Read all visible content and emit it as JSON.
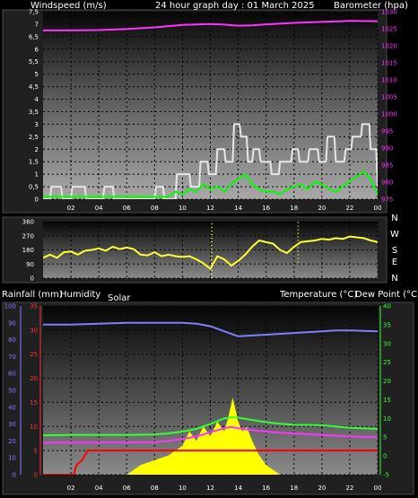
{
  "header": {
    "windspeed_label": "Windspeed (m/s)",
    "title": "24 hour graph day : 01 March 2025",
    "barometer_label": "Barometer (hpa)"
  },
  "labels": {
    "rainfall": "Rainfall (mm)",
    "humidity": "Humidity",
    "solar": "Solar",
    "temperature": "Temperature (°C)",
    "dew_point": "Dew Point (°C)"
  },
  "compass": [
    "N",
    "W",
    "S",
    "E",
    "N"
  ],
  "colors": {
    "wind_speed": "#e6e6e6",
    "wind_gust_avg": "#00ff00",
    "barometer": "#ff33ff",
    "direction": "#ffff33",
    "humidity": "#7f7fff",
    "temperature": "#33ff33",
    "dew_point": "#ff33ff",
    "solar": "#ffff00",
    "rain": "#ff0000",
    "wind_axis": "#ffffff",
    "baro_axis": "#ff33ff",
    "rain_axis": "#ff3333",
    "humidity_axis": "#7f7fff",
    "temp_axis": "#33ff33"
  },
  "chart_data": [
    {
      "type": "line",
      "name": "wind-baro",
      "x_ticks": [
        "02",
        "04",
        "06",
        "08",
        "10",
        "12",
        "14",
        "16",
        "18",
        "20",
        "22",
        "00"
      ],
      "x_range_hours": [
        0,
        24
      ],
      "y_left": {
        "label": "Windspeed (m/s)",
        "range": [
          0,
          7.5
        ],
        "ticks": [
          "0",
          "0,5",
          "1",
          "1,5",
          "2",
          "2,5",
          "3",
          "3,5",
          "4",
          "4,5",
          "5",
          "5,5",
          "6",
          "6,5",
          "7",
          "7,5"
        ]
      },
      "y_right": {
        "label": "Barometer (hpa)",
        "range": [
          975,
          1030
        ],
        "ticks": [
          "975",
          "980",
          "985",
          "990",
          "995",
          "1000",
          "1005",
          "1010",
          "1015",
          "1020",
          "1025",
          "1030"
        ]
      },
      "barometer": {
        "x": [
          0,
          2,
          4,
          6,
          8,
          10,
          12,
          13,
          14,
          15,
          16,
          18,
          20,
          22,
          24
        ],
        "y": [
          1024.5,
          1024.5,
          1024.6,
          1024.9,
          1025.4,
          1026.1,
          1026.4,
          1026.2,
          1025.9,
          1026,
          1026.3,
          1026.7,
          1027,
          1027.3,
          1027.2
        ]
      },
      "wind_gust": {
        "x": [
          0,
          0.5,
          0.6,
          1.3,
          1.4,
          2,
          2.1,
          3,
          3.1,
          4.3,
          4.4,
          5,
          5.1,
          8,
          8.1,
          8.6,
          8.7,
          9.5,
          9.6,
          10.5,
          10.6,
          11.2,
          11.3,
          11.8,
          11.9,
          12.4,
          12.5,
          13,
          13.1,
          13.6,
          13.7,
          14.1,
          14.2,
          14.6,
          14.7,
          15,
          15.1,
          15.5,
          15.6,
          16.3,
          16.4,
          16.9,
          17,
          17.8,
          17.9,
          18.3,
          18.4,
          19,
          19.1,
          19.7,
          19.8,
          20.3,
          20.4,
          20.9,
          21,
          21.6,
          21.7,
          22.1,
          22.2,
          22.8,
          22.9,
          23.4,
          23.5,
          23.9,
          24
        ],
        "y": [
          0,
          0,
          0.5,
          0.5,
          0,
          0,
          0.5,
          0.5,
          0,
          0,
          0.5,
          0.5,
          0,
          0,
          0.5,
          0.5,
          0,
          0,
          1,
          1,
          0.5,
          0.5,
          1.5,
          1.5,
          1,
          1,
          2,
          2,
          1.5,
          1.5,
          3,
          3,
          2.5,
          2.5,
          1.5,
          1.5,
          2,
          2,
          1.5,
          1.5,
          1,
          1,
          1.5,
          1.5,
          2,
          2,
          1.5,
          1.5,
          2,
          2,
          1.5,
          1.5,
          2.5,
          2.5,
          1.5,
          1.5,
          2,
          2,
          2.5,
          2.5,
          3,
          3,
          2,
          2,
          0.5
        ]
      },
      "wind_avg": {
        "x": [
          0,
          1,
          2,
          3,
          4,
          5,
          6,
          7,
          8,
          9,
          9.5,
          10,
          10.5,
          11,
          11.5,
          12,
          12.5,
          13,
          13.5,
          14,
          14.5,
          15,
          15.5,
          16,
          16.5,
          17,
          17.5,
          18,
          18.5,
          19,
          19.5,
          20,
          20.5,
          21,
          21.5,
          22,
          22.5,
          23,
          23.5,
          24
        ],
        "y": [
          0.1,
          0.1,
          0.1,
          0.1,
          0.1,
          0.1,
          0.1,
          0.1,
          0.1,
          0.1,
          0.3,
          0.2,
          0.4,
          0.3,
          0.6,
          0.4,
          0.5,
          0.3,
          0.6,
          0.8,
          1,
          0.6,
          0.4,
          0.3,
          0.3,
          0.2,
          0.4,
          0.5,
          0.6,
          0.4,
          0.7,
          0.6,
          0.4,
          0.3,
          0.5,
          0.7,
          0.9,
          1.1,
          0.8,
          0.2
        ]
      }
    },
    {
      "type": "line",
      "name": "wind-direction",
      "y_range": [
        0,
        360
      ],
      "y_ticks": [
        "0",
        "90",
        "180",
        "270",
        "360"
      ],
      "x": [
        0,
        0.5,
        1,
        1.5,
        2,
        2.5,
        3,
        3.5,
        4,
        4.5,
        5,
        5.5,
        6,
        6.5,
        7,
        7.5,
        8,
        8.5,
        9,
        9.5,
        10,
        10.5,
        11,
        11.5,
        12,
        12.5,
        13,
        13.5,
        14,
        14.5,
        15,
        15.5,
        16,
        16.5,
        17,
        17.5,
        18,
        18.5,
        19,
        19.5,
        20,
        20.5,
        21,
        21.5,
        22,
        22.5,
        23,
        23.5,
        24
      ],
      "y": [
        130,
        150,
        130,
        165,
        170,
        150,
        175,
        180,
        190,
        175,
        200,
        185,
        195,
        185,
        150,
        145,
        165,
        140,
        150,
        140,
        135,
        140,
        120,
        95,
        60,
        140,
        120,
        80,
        110,
        150,
        200,
        240,
        230,
        220,
        180,
        160,
        200,
        230,
        235,
        240,
        250,
        245,
        255,
        250,
        265,
        260,
        255,
        240,
        230
      ]
    },
    {
      "type": "line",
      "name": "rain-humidity-solar-temperature",
      "x_ticks": [
        "02",
        "04",
        "06",
        "08",
        "10",
        "12",
        "14",
        "16",
        "18",
        "20",
        "22",
        "00"
      ],
      "y_humidity": {
        "range": [
          0,
          100
        ],
        "ticks": [
          "0",
          "10",
          "20",
          "30",
          "40",
          "50",
          "60",
          "70",
          "80",
          "90",
          "100"
        ]
      },
      "y_rain": {
        "range": [
          0,
          35
        ],
        "ticks": [
          "0",
          "5",
          "10",
          "15",
          "20",
          "25",
          "30",
          "35"
        ]
      },
      "y_temperature": {
        "range": [
          -5,
          40
        ],
        "ticks": [
          "-5",
          "0",
          "5",
          "10",
          "15",
          "20",
          "25",
          "30",
          "35",
          "40"
        ]
      },
      "humidity": {
        "x": [
          0,
          2,
          4,
          6,
          8,
          10,
          11,
          12,
          13,
          14,
          15,
          16,
          18,
          20,
          21,
          22,
          24
        ],
        "y": [
          89,
          89,
          89.5,
          90,
          90,
          90,
          89.5,
          88,
          85,
          82,
          82.5,
          83,
          84,
          85,
          85.5,
          85.5,
          85
        ]
      },
      "temperature": {
        "x": [
          0,
          2,
          4,
          6,
          8,
          9,
          10,
          11,
          12,
          13,
          13.5,
          14,
          15,
          16,
          17,
          18,
          20,
          22,
          24
        ],
        "y": [
          5.5,
          5.6,
          5.6,
          5.6,
          5.7,
          6,
          6.5,
          7.2,
          8.5,
          10,
          10.3,
          10.2,
          9.6,
          9,
          8.6,
          8.3,
          8.2,
          7.5,
          7.2
        ]
      },
      "dew_point": {
        "x": [
          0,
          2,
          4,
          6,
          8,
          9,
          10,
          11,
          12,
          13,
          13.5,
          14,
          15,
          16,
          17,
          18,
          20,
          22,
          24
        ],
        "y": [
          3.5,
          3.6,
          3.6,
          3.6,
          3.7,
          4,
          4.5,
          5.2,
          6.3,
          7.4,
          7.7,
          7.4,
          6.9,
          6.5,
          6.2,
          6,
          5.6,
          5.2,
          5
        ]
      },
      "solar": {
        "x": [
          0,
          6,
          6.5,
          7,
          8,
          9,
          10,
          10.5,
          11,
          11.5,
          12,
          12.5,
          13,
          13.3,
          13.6,
          14,
          14.3,
          14.6,
          15,
          15.5,
          16,
          16.5,
          17,
          24
        ],
        "y": [
          0,
          0,
          1,
          2,
          3,
          4,
          6,
          9,
          7,
          10,
          8,
          11,
          9,
          12,
          16,
          11,
          9,
          10,
          7,
          4,
          2,
          1,
          0,
          0
        ]
      },
      "rain": {
        "x": [
          0,
          2.2,
          2.4,
          2.8,
          3,
          3.2,
          24
        ],
        "y": [
          0,
          0,
          2,
          3,
          4,
          5,
          5
        ]
      }
    }
  ]
}
